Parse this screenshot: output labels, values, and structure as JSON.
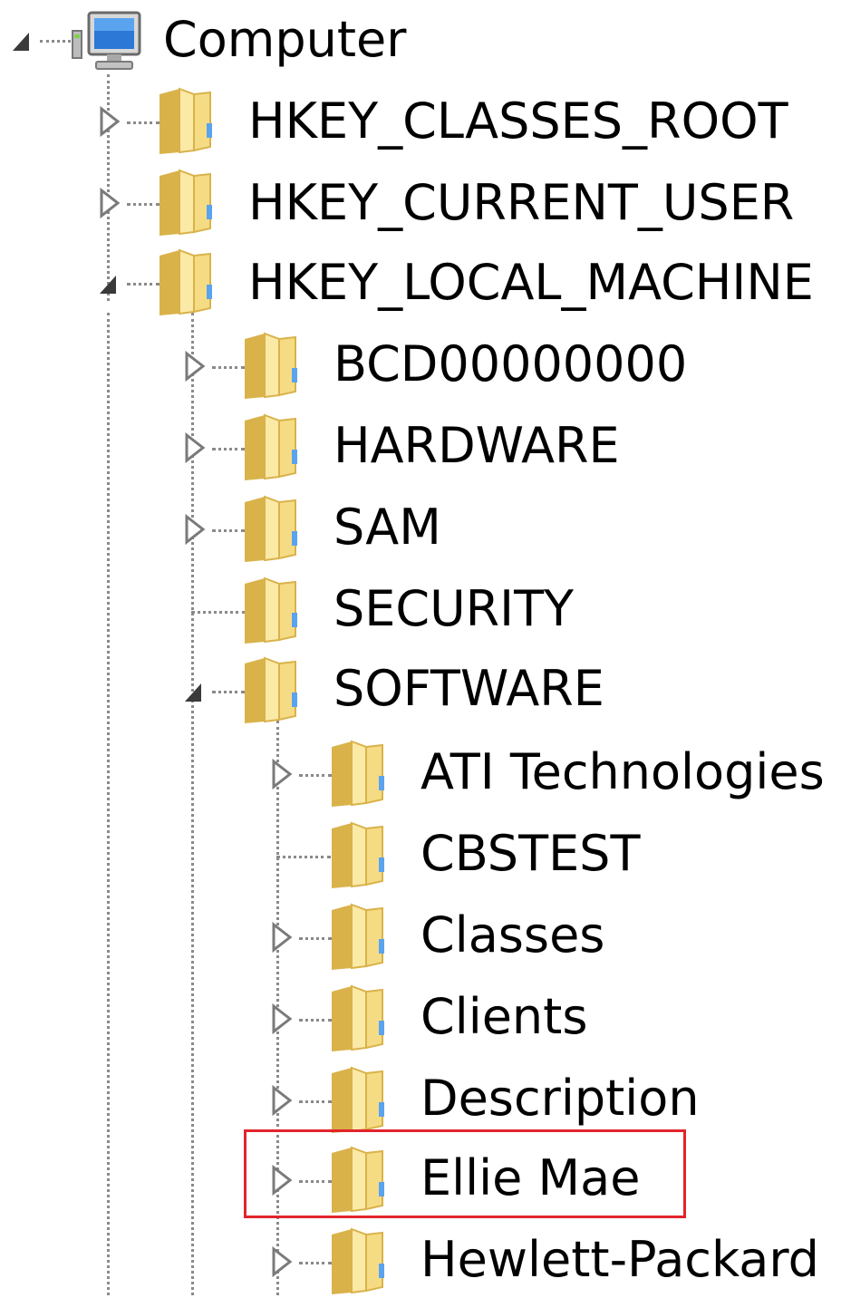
{
  "tree": {
    "root": {
      "label": "Computer",
      "icon": "computer-icon",
      "expanded": true
    },
    "hives": [
      {
        "label": "HKEY_CLASSES_ROOT",
        "expanded": false,
        "has_children": true
      },
      {
        "label": "HKEY_CURRENT_USER",
        "expanded": false,
        "has_children": true
      },
      {
        "label": "HKEY_LOCAL_MACHINE",
        "expanded": true,
        "has_children": true
      }
    ],
    "local_machine_children": [
      {
        "label": "BCD00000000",
        "expanded": false,
        "has_children": true
      },
      {
        "label": "HARDWARE",
        "expanded": false,
        "has_children": true
      },
      {
        "label": "SAM",
        "expanded": false,
        "has_children": true
      },
      {
        "label": "SECURITY",
        "expanded": false,
        "has_children": false
      },
      {
        "label": "SOFTWARE",
        "expanded": true,
        "has_children": true
      }
    ],
    "software_children": [
      {
        "label": "ATI Technologies",
        "expanded": false,
        "has_children": true
      },
      {
        "label": "CBSTEST",
        "expanded": false,
        "has_children": false
      },
      {
        "label": "Classes",
        "expanded": false,
        "has_children": true
      },
      {
        "label": "Clients",
        "expanded": false,
        "has_children": true
      },
      {
        "label": "Description",
        "expanded": false,
        "has_children": true
      },
      {
        "label": "Ellie Mae",
        "expanded": false,
        "has_children": true,
        "highlighted": true
      },
      {
        "label": "Hewlett-Packard",
        "expanded": false,
        "has_children": true
      }
    ]
  },
  "colors": {
    "highlight_border": "#e2242b",
    "connector": "#8a8a8a",
    "folder_light": "#fbe9a6",
    "folder_dark": "#d9b24a",
    "text": "#000000"
  }
}
